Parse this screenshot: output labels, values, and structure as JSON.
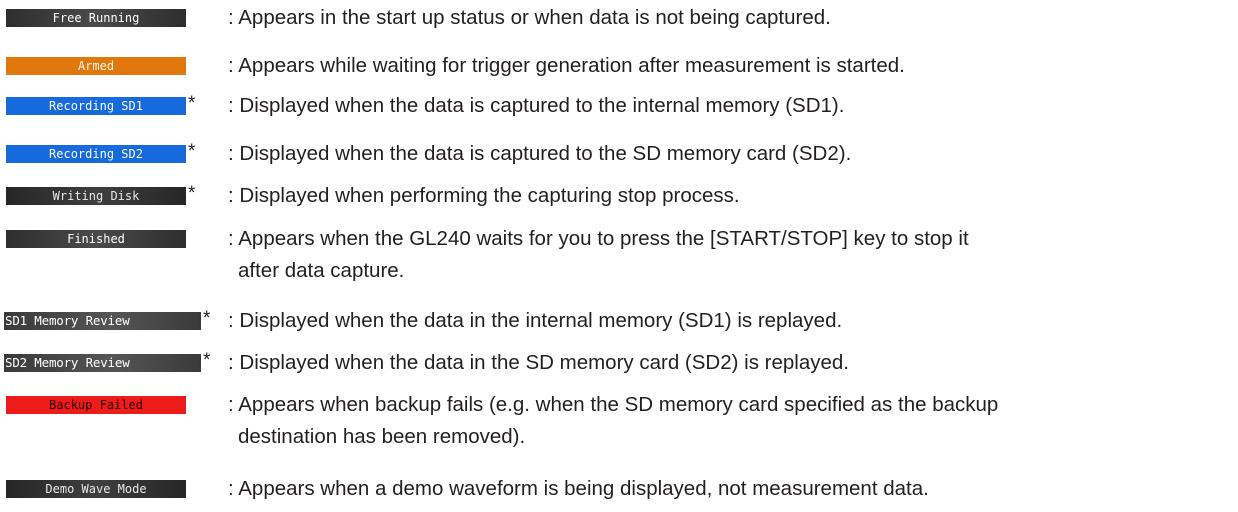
{
  "items": [
    {
      "badge": "Free Running",
      "marker": "",
      "desc": ": Appears in the start up status or when data is not being captured."
    },
    {
      "badge": "Armed",
      "marker": "",
      "desc": ": Appears while waiting for trigger generation after measurement is started."
    },
    {
      "badge": "Recording SD1",
      "marker": "*",
      "desc": ": Displayed when the data is captured to the internal memory (SD1)."
    },
    {
      "badge": "Recording SD2",
      "marker": "*",
      "desc": ": Displayed when the data is captured to the SD memory card (SD2)."
    },
    {
      "badge": "Writing Disk",
      "marker": "*",
      "desc": ": Displayed when performing the capturing stop process."
    },
    {
      "badge": "Finished",
      "marker": "",
      "desc": ": Appears when the GL240 waits for you to press the [START/STOP] key to stop it",
      "desc2": "after data capture."
    },
    {
      "badge": "SD1 Memory Review",
      "marker": "*",
      "desc": ": Displayed when the data in the internal memory (SD1) is replayed."
    },
    {
      "badge": "SD2 Memory Review",
      "marker": "*",
      "desc": ": Displayed when the data in the SD memory card (SD2) is replayed."
    },
    {
      "badge": "Backup Failed",
      "marker": "",
      "desc": ": Appears when backup fails (e.g. when the SD memory card specified as the backup",
      "desc2": "destination has been removed)."
    },
    {
      "badge": "Demo Wave Mode",
      "marker": "",
      "desc": ": Appears when a demo waveform is being displayed, not measurement data."
    }
  ],
  "colors": {
    "gray": "#3a3a3a",
    "orange": "#e0780e",
    "blue": "#1769de",
    "red": "#ee1b1b",
    "text": "#231f20"
  }
}
